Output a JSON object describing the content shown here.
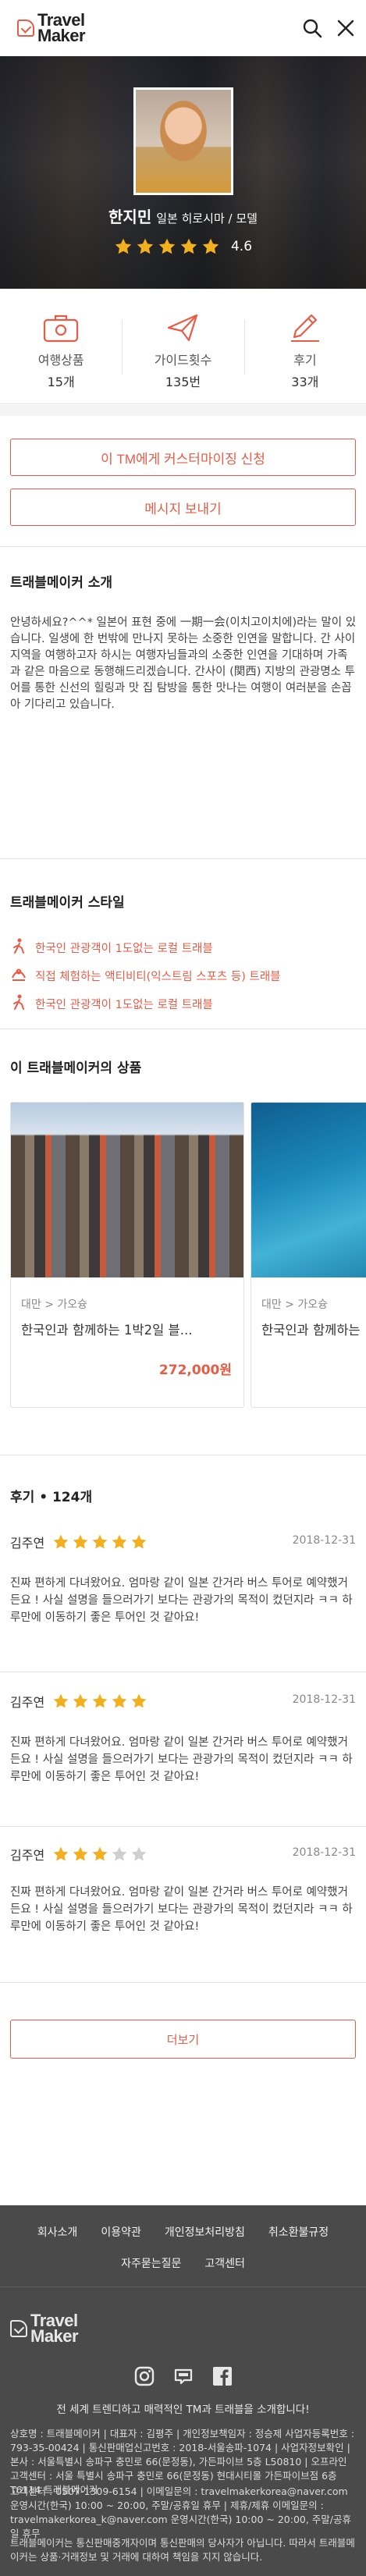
{
  "header": {
    "logo_line1": "Travel",
    "logo_line2": "Maker"
  },
  "hero": {
    "name": "한지민",
    "region": "일본 히로시마 / 모델",
    "rating": 4.6,
    "rating_label": "4.6"
  },
  "stats": [
    {
      "label": "여행상품",
      "value": "15개",
      "icon": "suitcase-icon"
    },
    {
      "label": "가이드횟수",
      "value": "135번",
      "icon": "paper-plane-icon"
    },
    {
      "label": "후기",
      "value": "33개",
      "icon": "pencil-icon"
    }
  ],
  "actions": {
    "customize": "이 TM에게 커스터마이징 신청",
    "message": "메시지 보내기"
  },
  "intro": {
    "title": "트래블메이커 소개",
    "text": "안녕하세요?^^* 일본어 표현 중에 一期一会(이치고이치에)라는 말이 있습니다. 일생에 한 번밖에 만나지 못하는 소중한 인연을 말합니다. 간 사이 지역을 여행하고자 하시는 여행자님들과의 소중한 인연을 기대하며 가족과 같은 마음으로 동행해드리겠습니다. 간사이 (関西) 지방의 관광명소 투어를 통한 신선의 힐링과 맛 집 탐방을 통한 맛나는 여행이 여러분을 손꼽아 기다리고 있습니다."
  },
  "style": {
    "title": "트래블메이커 스타일",
    "items": [
      "한국인 관광객이 1도없는 로컬 트래블",
      "직접 체험하는 액티비티(익스트림 스포츠 등) 트래블",
      "한국인 관광객이 1도없는 로컬 트래블"
    ]
  },
  "products": {
    "title": "이 트래블메이커의 상품",
    "items": [
      {
        "category": "대만 > 가오슝",
        "title": "한국인과 함께하는 1박2일 블...",
        "price": "272,000원"
      },
      {
        "category": "대만 > 가오슝",
        "title": "한국인과 함께하는",
        "price": ""
      }
    ]
  },
  "reviews": {
    "title": "후기 • 124개",
    "items": [
      {
        "name": "김주연",
        "stars": 5,
        "date": "2018-12-31",
        "text": "진짜 편하게 다녀왔어요. 엄마랑 같이 일본 간거라 버스 투어로 예약했거든요 ! 사실 설명을 들으러가기 보다는 관광가의 목적이 컸던지라 ㅋㅋ 하루만에 이동하기 좋은 투어인 것 같아요!"
      },
      {
        "name": "김주연",
        "stars": 5,
        "date": "2018-12-31",
        "text": "진짜 편하게 다녀왔어요. 엄마랑 같이 일본 간거라 버스 투어로 예약했거든요 ! 사실 설명을 들으러가기 보다는 관광가의 목적이 컸던지라 ㅋㅋ 하루만에 이동하기 좋은 투어인 것 같아요!"
      },
      {
        "name": "김주연",
        "stars": 3,
        "date": "2018-12-31",
        "text": "진짜 편하게 다녀왔어요. 엄마랑 같이 일본 간거라 버스 투어로 예약했거든요 ! 사실 설명을 들으러가기 보다는 관광가의 목적이 컸던지라 ㅋㅋ 하루만에 이동하기 좋은 투어인 것 같아요!"
      }
    ],
    "more": "더보기"
  },
  "footer": {
    "nav": [
      "회사소개",
      "이용약관",
      "개인정보처리방침",
      "취소환불규정",
      "자주묻는질문",
      "고객센터"
    ],
    "logo_line1": "Travel",
    "logo_line2": "Maker",
    "tagline": "전 세계 트렌디하고 매력적인 TM과 트래블을 소개합니다!",
    "company": "상호명 : 트래블메이커 | 대표자 : 김평주 | 개인정보책임자 : 정승제 사업자등록번호 : 793-35-00424 | 통신판매업신고번호 : 2018-서울송파-1074 | 사업자정보확인 | 본사 : 서울특별시 송파구 충민로 66(문정동), 가든파이브 5층 L50810 | 오프라인 고객센터 : 서울 특별시 송파구 충민로 66(문정동) 현대시티몰 가든파이브점 6층 T6114 트래블메이커",
    "contact": "고객센터 : 0507-1309-6154 | 이메일문의 : travelmakerkorea@naver.com 운영시간(한국) 10:00 ~ 20:00, 주말/공휴일 휴무 | 제휴/제휴 이메일문의 : travelmakerkorea_k@naver.com 운영시간(한국) 10:00 ~ 20:00, 주말/공휴일 휴무",
    "notice": "트래블메이커는 통신판매중개자이며 통신판매의 당사자가 아닙니다. 따라서 트래블메이커는 상품·거래정보 및 거래에 대하여 책임을 지지 않습니다."
  },
  "colors": {
    "accent": "#e95b45",
    "star": "#f2b01e",
    "footer_bg": "#4a4a4a"
  }
}
